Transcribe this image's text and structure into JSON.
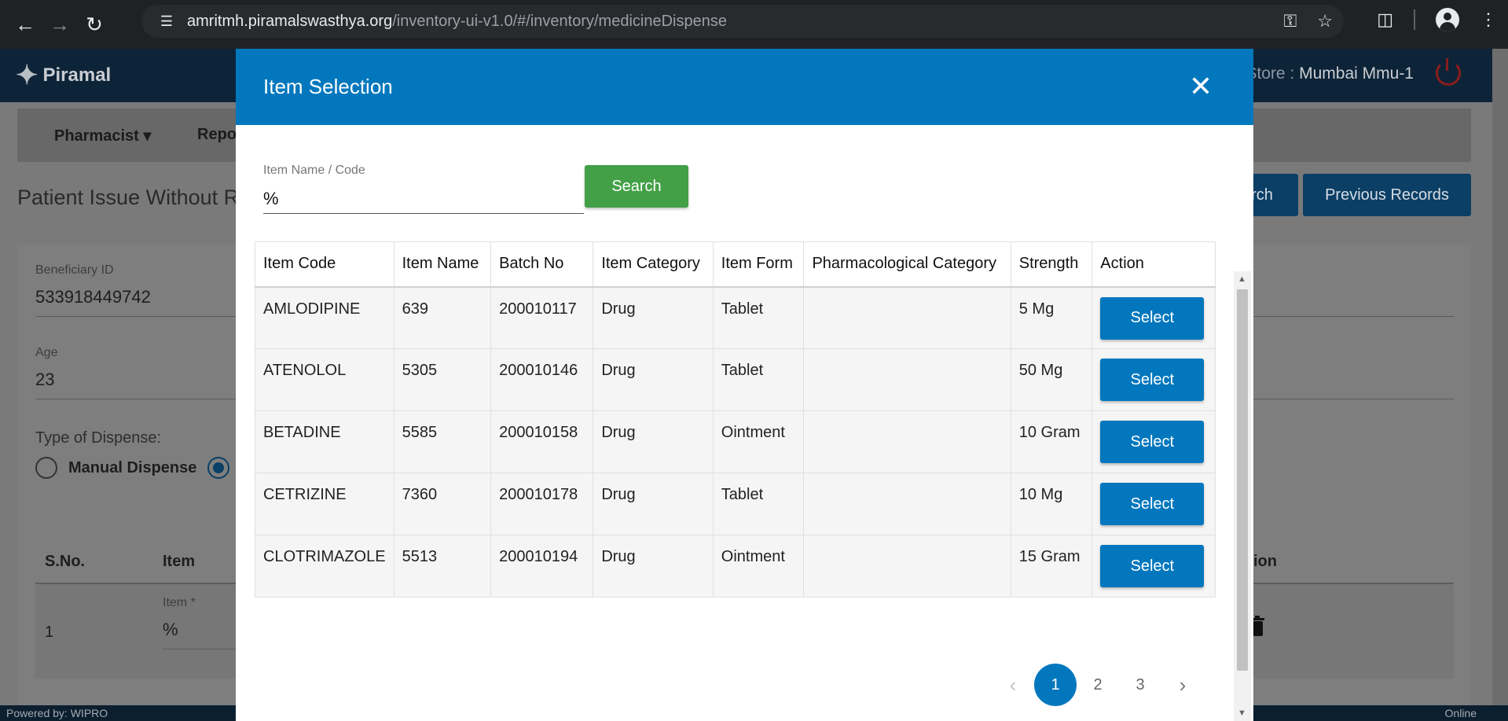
{
  "browser": {
    "url_host": "amritmh.piramalswasthya.org",
    "url_path": "/inventory-ui-v1.0/#/inventory/medicineDispense"
  },
  "app": {
    "brand": "Piramal",
    "store_label": "Store :",
    "store_value": "Mumbai Mmu-1",
    "menu": [
      "Pharmacist",
      "Repo"
    ],
    "page_title": "Patient Issue Without Rx",
    "buttons": {
      "search_partial": "rch",
      "previous_records": "Previous Records"
    },
    "beneficiary_id_label": "Beneficiary ID",
    "beneficiary_id_value": "533918449742",
    "age_label": "Age",
    "age_value": "23",
    "dispense_type_label": "Type of Dispense:",
    "manual_dispense_label": "Manual Dispense",
    "table_headers": {
      "sno": "S.No.",
      "item": "Item",
      "action_partial": "ion"
    },
    "row": {
      "sno": "1",
      "item_label": "Item *",
      "item_value": "%"
    },
    "footer_left": "Powered by: WIPRO",
    "footer_right": "Online"
  },
  "modal": {
    "title": "Item Selection",
    "field_label": "Item Name / Code",
    "field_value": "%",
    "search_label": "Search",
    "columns": [
      "Item Code",
      "Item Name",
      "Batch No",
      "Item Category",
      "Item Form",
      "Pharmacological Category",
      "Strength",
      "Action"
    ],
    "rows": [
      {
        "code": "AMLODIPINE",
        "name": "639",
        "batch": "200010117",
        "category": "Drug",
        "form": "Tablet",
        "pharma": "",
        "strength": "5 Mg",
        "action": "Select"
      },
      {
        "code": "ATENOLOL",
        "name": "5305",
        "batch": "200010146",
        "category": "Drug",
        "form": "Tablet",
        "pharma": "",
        "strength": "50 Mg",
        "action": "Select"
      },
      {
        "code": "BETADINE",
        "name": "5585",
        "batch": "200010158",
        "category": "Drug",
        "form": "Ointment",
        "pharma": "",
        "strength": "10 Gram",
        "action": "Select"
      },
      {
        "code": "CETRIZINE",
        "name": "7360",
        "batch": "200010178",
        "category": "Drug",
        "form": "Tablet",
        "pharma": "",
        "strength": "10 Mg",
        "action": "Select"
      },
      {
        "code": "CLOTRIMAZOLE",
        "name": "5513",
        "batch": "200010194",
        "category": "Drug",
        "form": "Ointment",
        "pharma": "",
        "strength": "15 Gram",
        "action": "Select"
      }
    ],
    "pagination": {
      "pages": [
        "1",
        "2",
        "3"
      ],
      "current": "1"
    }
  },
  "colors": {
    "modal_header": "#0277bd",
    "search_button": "#43a047",
    "select_button": "#0277bd"
  },
  "icons": [
    "back-arrow-icon",
    "forward-arrow-icon",
    "reload-icon",
    "site-info-icon",
    "key-icon",
    "star-icon",
    "extensions-icon",
    "profile-icon",
    "kebab-menu-icon",
    "power-icon",
    "close-icon",
    "trash-icon",
    "chevron-left-icon",
    "chevron-right-icon"
  ]
}
